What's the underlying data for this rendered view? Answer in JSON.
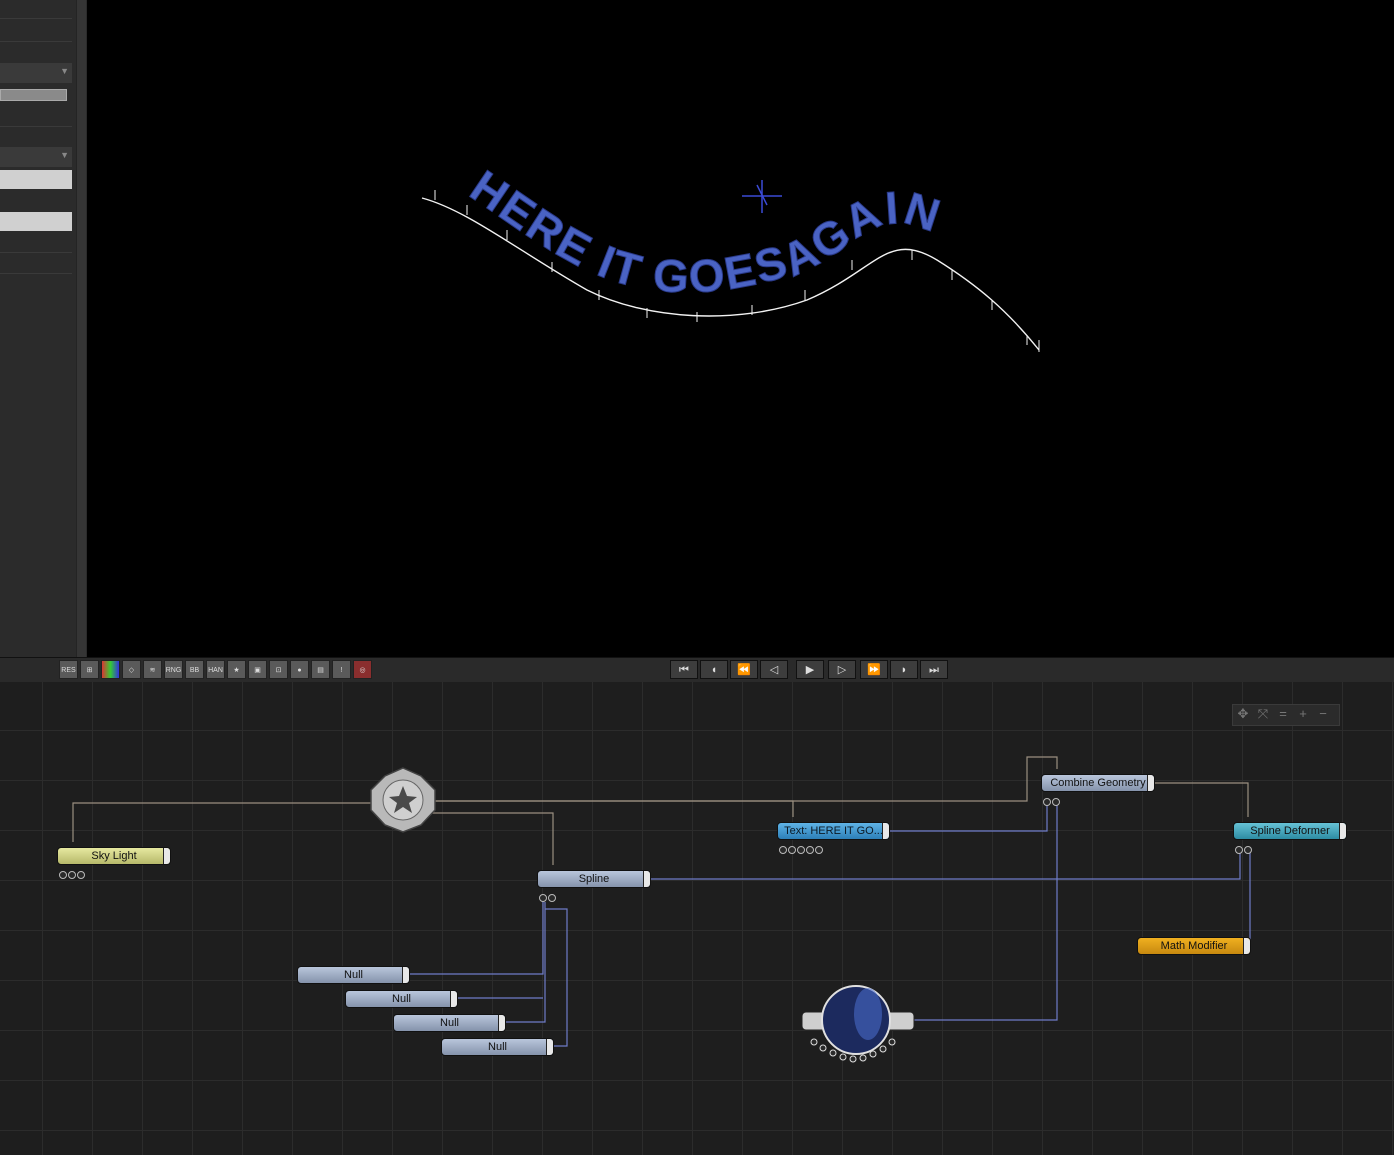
{
  "viewport": {
    "text_3d": "HERE IT GOESAGAIN",
    "text_color": "#4a63c4"
  },
  "toolbar": {
    "buttons": [
      {
        "label": "RES",
        "icon": "res-icon"
      },
      {
        "label": "",
        "icon": "grid-icon"
      },
      {
        "label": "",
        "icon": "color-channels-icon"
      },
      {
        "label": "",
        "icon": "wireframe-cube-icon"
      },
      {
        "label": "",
        "icon": "layers-icon"
      },
      {
        "label": "RNG",
        "icon": "rng-icon"
      },
      {
        "label": "BB",
        "icon": "bounding-box-icon"
      },
      {
        "label": "HAN",
        "icon": "handles-icon"
      },
      {
        "label": "",
        "icon": "star-icon"
      },
      {
        "label": "",
        "icon": "camera-cube-icon"
      },
      {
        "label": "",
        "icon": "stereo-icon"
      },
      {
        "label": "",
        "icon": "sphere-shading-icon"
      },
      {
        "label": "",
        "icon": "film-icon"
      },
      {
        "label": "",
        "icon": "warning-icon"
      },
      {
        "label": "",
        "icon": "record-icon"
      }
    ],
    "transport": [
      {
        "glyph": "⏮",
        "icon": "go-to-start-icon"
      },
      {
        "glyph": "◖",
        "icon": "previous-key-icon"
      },
      {
        "glyph": "⏪",
        "icon": "rewind-icon"
      },
      {
        "glyph": "◁",
        "icon": "step-back-icon"
      },
      {
        "glyph": "▶",
        "icon": "play-icon"
      },
      {
        "glyph": "▷",
        "icon": "step-forward-icon"
      },
      {
        "glyph": "⏩",
        "icon": "fast-forward-icon"
      },
      {
        "glyph": "◗",
        "icon": "next-key-icon"
      },
      {
        "glyph": "⏭",
        "icon": "go-to-end-icon"
      }
    ]
  },
  "nodes": {
    "sky_light": "Sky  Light",
    "spline": "Spline",
    "text": "Text:  HERE  IT  GO...",
    "combine_geometry": "Combine  Geometry",
    "spline_deformer": "Spline  Deformer",
    "math_modifier": "Math  Modifier",
    "null_1": "Null",
    "null_2": "Null",
    "null_3": "Null",
    "null_4": "Null"
  },
  "graph_nav": {
    "buttons": [
      "move-icon",
      "fit-icon",
      "align-icon",
      "zoom-in-icon",
      "zoom-out-icon"
    ]
  }
}
